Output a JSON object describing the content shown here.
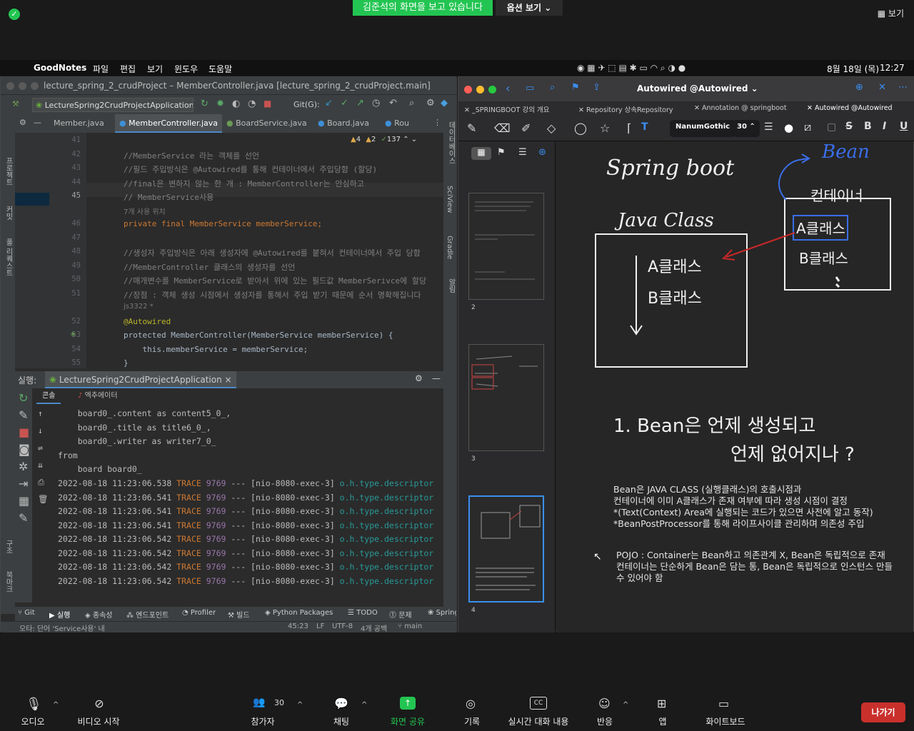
{
  "zoom": {
    "banner": "김준석의 화면을 보고 있습니다",
    "view_options": "옵션 보기",
    "view": "보기",
    "bottom": {
      "audio": "오디오",
      "video": "비디오 시작",
      "participants": "참가자",
      "participants_count": "30",
      "chat": "채팅",
      "share": "화면 공유",
      "record": "기록",
      "captions": "실시간 대화 내용",
      "reactions": "반응",
      "apps": "앱",
      "whiteboard": "화이트보드",
      "leave": "나가기"
    }
  },
  "menubar": {
    "app": "GoodNotes",
    "items": [
      "파일",
      "편집",
      "보기",
      "윈도우",
      "도움말"
    ],
    "date": "8월 18일 (목)",
    "time": "12:27"
  },
  "ide": {
    "title": "lecture_spring_2_crudProject – MemberController.java [lecture_spring_2_crudProject.main]",
    "run_config": "LectureSpring2CrudProjectApplication",
    "git_label": "Git(G):",
    "tabs": [
      "Member.java",
      "MemberController.java",
      "BoardService.java",
      "Board.java",
      "Rou"
    ],
    "left_strip": [
      "프로젝트",
      "커밋",
      "풀 리퀘스트",
      "북마크",
      "구조"
    ],
    "right_strip": [
      "데이터베이스",
      "SciView",
      "Gradle",
      "알림"
    ],
    "inspections": {
      "warn": "4",
      "weak": "2",
      "typo": "137"
    },
    "lines": [
      {
        "n": "41",
        "t": ""
      },
      {
        "n": "42",
        "t": "//MemberService 라는 객체를 선언"
      },
      {
        "n": "43",
        "t": "//필드 주입방식은 @Autowired를 통해 컨테이너에서 주입당함 (할당)"
      },
      {
        "n": "44",
        "t": "//final은 변하지 않는 한 개 : MemberController는 안심하고"
      },
      {
        "n": "45",
        "t": "// MemberService사용"
      },
      {
        "n": "46",
        "t": "private final MemberService memberService;"
      },
      {
        "n": "47",
        "t": ""
      },
      {
        "n": "48",
        "t": "//생성자 주입방식은 아래 생성자에 @Autowired를 붙혀서 컨테이너에서 주입 당함"
      },
      {
        "n": "49",
        "t": "//MemberController 클래스의 생성자를 선언"
      },
      {
        "n": "50",
        "t": "//매개변수를 MemberService로 받아서 위에 있는 필드값 MemberSerivce에 할당"
      },
      {
        "n": "51",
        "t": "//장점 : 객체 생성 시점에서 생성자를 통해서 주입 받기 때문에 순서 명확해집니다"
      },
      {
        "n": "52",
        "t": "@Autowired"
      },
      {
        "n": "53",
        "t": "protected MemberController(MemberService memberService) {"
      },
      {
        "n": "54",
        "t": "    this.memberService = memberService;"
      },
      {
        "n": "55",
        "t": "}"
      }
    ],
    "usages_hint": "7개 사용 위치",
    "author_hint": "js3322 *",
    "run_label": "실행:",
    "run_tab": "LectureSpring2CrudProjectApplication",
    "console_tab": "콘솔",
    "actuator_tab": "엑추에이터",
    "console": [
      "    board0_.content as content5_0_,",
      "    board0_.title as title6_0_,",
      "    board0_.writer as writer7_0_",
      "from",
      "    board board0_"
    ],
    "trace_lines": [
      {
        "date": "2022-08-18 11:23:06.538",
        "level": "TRACE",
        "pid": "9769",
        "thread": "--- [nio-8080-exec-3]",
        "cls": "o.h.type.descriptor"
      },
      {
        "date": "2022-08-18 11:23:06.541",
        "level": "TRACE",
        "pid": "9769",
        "thread": "--- [nio-8080-exec-3]",
        "cls": "o.h.type.descriptor"
      },
      {
        "date": "2022-08-18 11:23:06.541",
        "level": "TRACE",
        "pid": "9769",
        "thread": "--- [nio-8080-exec-3]",
        "cls": "o.h.type.descriptor"
      },
      {
        "date": "2022-08-18 11:23:06.541",
        "level": "TRACE",
        "pid": "9769",
        "thread": "--- [nio-8080-exec-3]",
        "cls": "o.h.type.descriptor"
      },
      {
        "date": "2022-08-18 11:23:06.542",
        "level": "TRACE",
        "pid": "9769",
        "thread": "--- [nio-8080-exec-3]",
        "cls": "o.h.type.descriptor"
      },
      {
        "date": "2022-08-18 11:23:06.542",
        "level": "TRACE",
        "pid": "9769",
        "thread": "--- [nio-8080-exec-3]",
        "cls": "o.h.type.descriptor"
      },
      {
        "date": "2022-08-18 11:23:06.542",
        "level": "TRACE",
        "pid": "9769",
        "thread": "--- [nio-8080-exec-3]",
        "cls": "o.h.type.descriptor"
      },
      {
        "date": "2022-08-18 11:23:06.542",
        "level": "TRACE",
        "pid": "9769",
        "thread": "--- [nio-8080-exec-3]",
        "cls": "o.h.type.descriptor"
      }
    ],
    "bottom_tabs": [
      "Git",
      "실행",
      "종속성",
      "엔드포인트",
      "Profiler",
      "빌드",
      "Python Packages",
      "TODO",
      "문제",
      "Spring"
    ],
    "status_left": "오타: 단어 'Service사용' 내",
    "status_pos": "45:23",
    "status_lf": "LF",
    "status_enc": "UTF-8",
    "status_indent": "4개 공백",
    "status_branch": "main"
  },
  "goodnotes": {
    "title": "Autowired @Autowired",
    "tabs": [
      "_SPRINGBOOT 강의 개요",
      "Repository 상속Repository",
      "Annotation @ springboot",
      "Autowired @Autowired"
    ],
    "font": "NanumGothic",
    "font_size": "30",
    "pages": [
      "2",
      "3",
      "4"
    ],
    "typed1": [
      "Bean은 JAVA CLASS (실행클래스)의 호출시점과",
      "컨테이너에 이미 A클래스가 존재 여부에 따라 생성 시점이 결정",
      "*(Text(Context) Area에 실행되는 코드가 있으면 사전에 알고 동작)",
      "*BeanPostProcessor를 통해 라이프사이클 관리하며 의존성 주입"
    ],
    "typed2": [
      "POJO : Container는 Bean하고 의존관계 X, Bean은 독립적으로 존재",
      "컨테이너는 단순하게 Bean은 담는 통, Bean은 독립적으로 인스턴스 만들",
      "수 있어야 함"
    ],
    "handwriting": {
      "title": "Spring boot",
      "bean": "Bean",
      "container": "컨테이너",
      "java_class": "Java Class",
      "a_class": "A클래스",
      "b_class": "B클래스",
      "question1": "1. Bean은   언제 생성되고",
      "question2": "언제 없어지나 ?"
    }
  }
}
